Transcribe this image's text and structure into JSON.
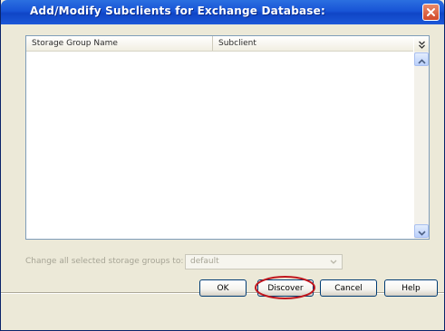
{
  "dialog": {
    "title": "Add/Modify Subclients for Exchange Database:"
  },
  "table": {
    "columns": [
      "Storage Group Name",
      "Subclient"
    ],
    "rows": []
  },
  "change_all": {
    "label": "Change all selected storage groups to:",
    "selected_value": "default",
    "enabled": false
  },
  "buttons": {
    "ok": "OK",
    "discover": "Discover",
    "cancel": "Cancel",
    "help": "Help"
  },
  "colors": {
    "titlebar": "#1854d6",
    "dialog_bg": "#ece9d8",
    "highlight_oval": "#c0161d"
  },
  "icons": {
    "close": "close-icon",
    "column_chooser": "double-chevron-down-icon",
    "scroll_up": "scroll-up-arrow-icon",
    "scroll_down": "scroll-down-arrow-icon",
    "dropdown": "chevron-down-icon"
  }
}
